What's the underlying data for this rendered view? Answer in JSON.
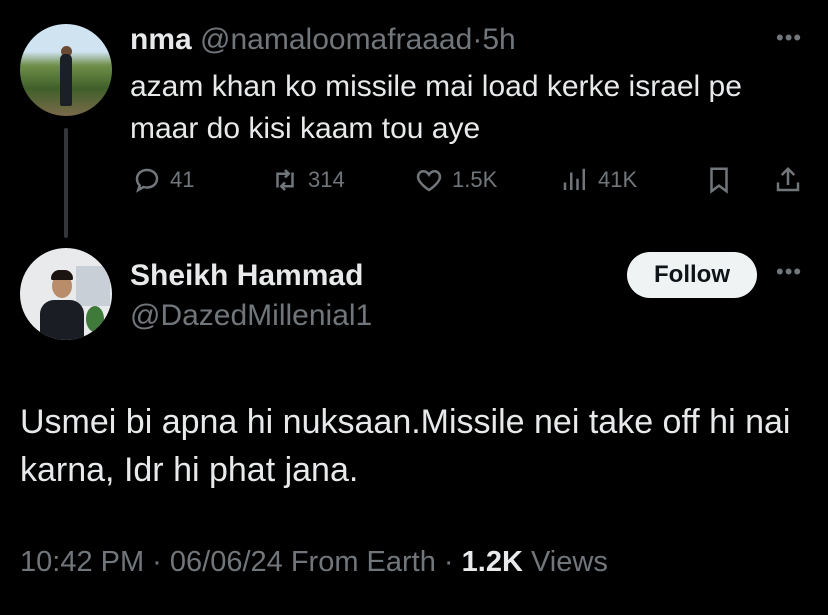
{
  "parent_tweet": {
    "display_name": "nma",
    "handle": "@namaloomafraaad",
    "separator": "·",
    "time_ago": "5h",
    "text": "azam khan ko missile mai load kerke israel pe maar do kisi kaam tou aye",
    "actions": {
      "replies": "41",
      "retweets": "314",
      "likes": "1.5K",
      "views": "41K"
    },
    "icons": [
      "reply-icon",
      "retweet-icon",
      "like-icon",
      "views-icon",
      "bookmark-icon",
      "share-icon",
      "more-icon"
    ]
  },
  "reply_tweet": {
    "display_name": "Sheikh Hammad",
    "handle": "@DazedMillenial1",
    "follow_label": "Follow",
    "text": "Usmei bi apna hi nuksaan.Missile nei take off hi nai karna, Idr hi phat jana.",
    "timestamp": "10:42 PM · 06/06/24 From Earth ·",
    "views_count": "1.2K",
    "views_label": "Views"
  },
  "colors": {
    "background": "#000000",
    "text_primary": "#e7e9ea",
    "text_secondary": "#71767b",
    "follow_button_bg": "#eff3f4",
    "thread_line": "#333639"
  }
}
